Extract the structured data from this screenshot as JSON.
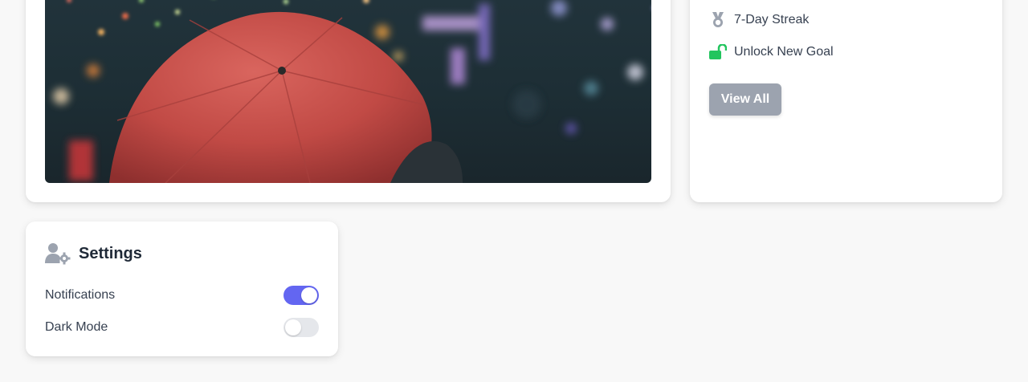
{
  "achievements": {
    "items": [
      {
        "label": "7-Day Streak",
        "icon": "medal-icon"
      },
      {
        "label": "Unlock New Goal",
        "icon": "unlock-icon"
      }
    ],
    "view_all_label": "View All"
  },
  "settings": {
    "title": "Settings",
    "icon": "user-gear-icon",
    "rows": [
      {
        "label": "Notifications",
        "enabled": true
      },
      {
        "label": "Dark Mode",
        "enabled": false
      }
    ]
  },
  "colors": {
    "toggle_on": "#6366f1",
    "toggle_off": "#e5e7eb",
    "unlock_icon": "#22c55e",
    "medal_icon": "#9ca3af",
    "button_bg": "#9ca3af"
  }
}
